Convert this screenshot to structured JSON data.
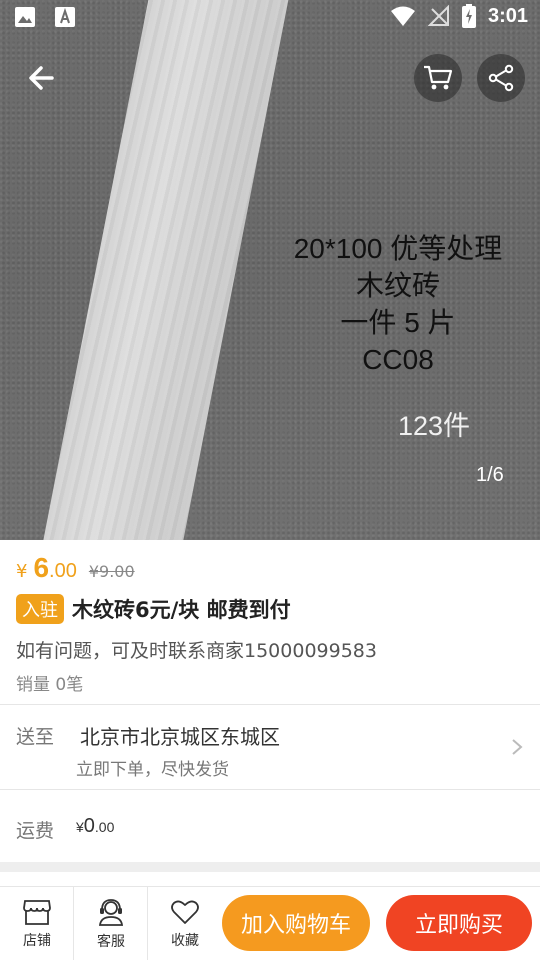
{
  "status_bar": {
    "time": "3:01"
  },
  "hero": {
    "overlay_lines": [
      "20*100 优等处理",
      "木纹砖",
      "一件 5 片",
      "CC08"
    ],
    "pieces": "123件",
    "page_indicator": "1/6"
  },
  "product": {
    "currency": "¥",
    "price_int": "6",
    "price_dec": ".00",
    "original_price": "¥9.00",
    "badge": "入驻",
    "title": "木纹砖6元/块 邮费到付",
    "description": "如有问题，可及时联系商家15000099583",
    "sales": "销量 0笔"
  },
  "shipping": {
    "label": "送至",
    "address": "北京市北京城区东城区",
    "note": "立即下单，尽快发货"
  },
  "freight": {
    "label": "运费",
    "currency": "¥",
    "int": "0",
    "dec": ".00"
  },
  "bottom_bar": {
    "store_label": "店铺",
    "service_label": "客服",
    "favorite_label": "收藏",
    "add_to_cart": "加入购物车",
    "buy_now": "立即购买"
  },
  "colors": {
    "accent": "#f0a11b",
    "cart_button": "#f59a1f",
    "buy_button": "#f04423"
  }
}
